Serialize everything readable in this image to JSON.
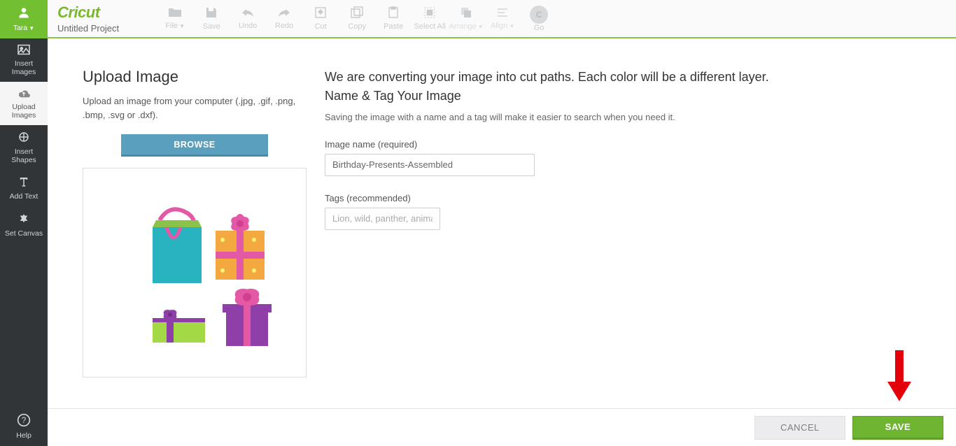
{
  "sidebar": {
    "user": "Tara",
    "items": [
      {
        "label": "Insert\nImages"
      },
      {
        "label": "Upload\nImages"
      },
      {
        "label": "Insert\nShapes"
      },
      {
        "label": "Add Text"
      },
      {
        "label": "Set Canvas"
      }
    ],
    "help": "Help"
  },
  "brand": {
    "name": "Cricut",
    "project": "Untitled Project"
  },
  "toolbar": {
    "file": "File",
    "save": "Save",
    "undo": "Undo",
    "redo": "Redo",
    "cut": "Cut",
    "copy": "Copy",
    "paste": "Paste",
    "selectall": "Select All",
    "arrange": "Arrange",
    "align": "Align",
    "go": "Go"
  },
  "upload": {
    "title": "Upload Image",
    "desc": "Upload an image from your computer (.jpg, .gif, .png, .bmp, .svg or .dxf).",
    "browse": "BROWSE"
  },
  "right": {
    "line1": "We are converting your image into cut paths. Each color will be a different layer.",
    "line2": "Name & Tag Your Image",
    "sub": "Saving the image with a name and a tag will make it easier to search when you need it.",
    "name_label": "Image name (required)",
    "name_value": "Birthday-Presents-Assembled",
    "tags_label": "Tags (recommended)",
    "tags_placeholder": "Lion, wild, panther, animal"
  },
  "footer": {
    "cancel": "CANCEL",
    "save": "SAVE"
  }
}
